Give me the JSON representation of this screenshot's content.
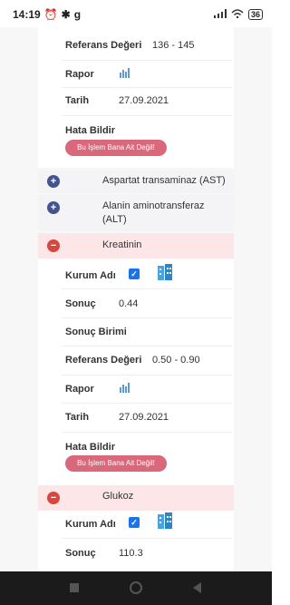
{
  "status_bar": {
    "time": "14:19",
    "battery": "36"
  },
  "labels": {
    "referans": "Referans Değeri",
    "rapor": "Rapor",
    "tarih": "Tarih",
    "hata": "Hata Bildir",
    "kurum": "Kurum Adı",
    "sonuc": "Sonuç",
    "sonuc_birimi": "Sonuç Birimi"
  },
  "first_item": {
    "referans": "136 - 145",
    "tarih": "27.09.2021",
    "error_button": "Bu İşlem Bana Ait Değil!"
  },
  "groups": [
    {
      "name": "Aspartat transaminaz (AST)",
      "state": "collapsed"
    },
    {
      "name": "Alanin aminotransferaz (ALT)",
      "state": "collapsed"
    }
  ],
  "kreatinin": {
    "title": "Kreatinin",
    "sonuc": "0.44",
    "referans": "0.50 - 0.90",
    "tarih": "27.09.2021",
    "error_button": "Bu İşlem Bana Ait Değil!"
  },
  "glukoz": {
    "title": "Glukoz",
    "sonuc": "110.3"
  },
  "colors": {
    "error_button": "#d8687a",
    "plus": "#44548e",
    "minus": "#d9463e",
    "highlight": "#fde6e8"
  }
}
